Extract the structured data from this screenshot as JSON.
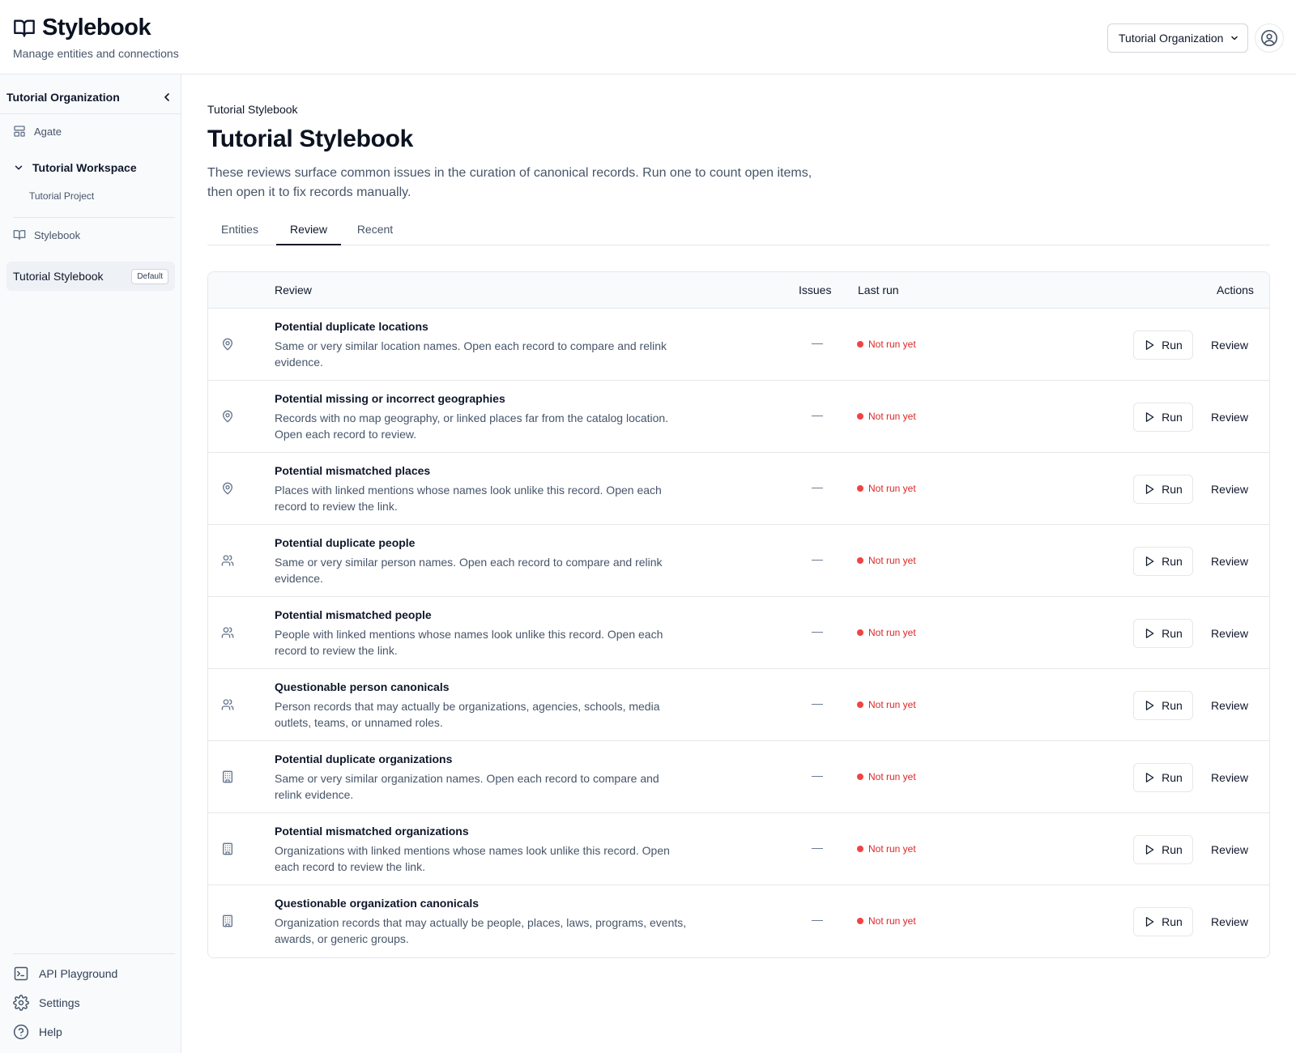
{
  "app": {
    "title": "Stylebook",
    "subtitle": "Manage entities and connections",
    "org_select": "Tutorial Organization"
  },
  "sidebar": {
    "org_name": "Tutorial Organization",
    "agate_label": "Agate",
    "workspace_label": "Tutorial Workspace",
    "project_label": "Tutorial Project",
    "stylebook_section": "Stylebook",
    "active_stylebook": "Tutorial Stylebook",
    "active_badge": "Default",
    "bottom": [
      "API Playground",
      "Settings",
      "Help"
    ]
  },
  "main": {
    "breadcrumb": "Tutorial Stylebook",
    "title": "Tutorial Stylebook",
    "description": "These reviews surface common issues in the curation of canonical records. Run one to count open items, then open it to fix records manually.",
    "tabs": [
      "Entities",
      "Review",
      "Recent"
    ],
    "active_tab": "Review"
  },
  "table": {
    "columns": {
      "review": "Review",
      "issues": "Issues",
      "last_run": "Last run",
      "actions": "Actions"
    },
    "run_label": "Run",
    "review_label": "Review",
    "rows": [
      {
        "icon": "map-pin-icon",
        "title": "Potential duplicate locations",
        "desc": "Same or very similar location names. Open each record to compare and relink evidence.",
        "issues": "—",
        "status": "Not run yet"
      },
      {
        "icon": "map-pin-icon",
        "title": "Potential missing or incorrect geographies",
        "desc": "Records with no map geography, or linked places far from the catalog location. Open each record to review.",
        "issues": "—",
        "status": "Not run yet"
      },
      {
        "icon": "map-pin-icon",
        "title": "Potential mismatched places",
        "desc": "Places with linked mentions whose names look unlike this record. Open each record to review the link.",
        "issues": "—",
        "status": "Not run yet"
      },
      {
        "icon": "users-icon",
        "title": "Potential duplicate people",
        "desc": "Same or very similar person names. Open each record to compare and relink evidence.",
        "issues": "—",
        "status": "Not run yet"
      },
      {
        "icon": "users-icon",
        "title": "Potential mismatched people",
        "desc": "People with linked mentions whose names look unlike this record. Open each record to review the link.",
        "issues": "—",
        "status": "Not run yet"
      },
      {
        "icon": "users-icon",
        "title": "Questionable person canonicals",
        "desc": "Person records that may actually be organizations, agencies, schools, media outlets, teams, or unnamed roles.",
        "issues": "—",
        "status": "Not run yet"
      },
      {
        "icon": "building-icon",
        "title": "Potential duplicate organizations",
        "desc": "Same or very similar organization names. Open each record to compare and relink evidence.",
        "issues": "—",
        "status": "Not run yet"
      },
      {
        "icon": "building-icon",
        "title": "Potential mismatched organizations",
        "desc": "Organizations with linked mentions whose names look unlike this record. Open each record to review the link.",
        "issues": "—",
        "status": "Not run yet"
      },
      {
        "icon": "building-icon",
        "title": "Questionable organization canonicals",
        "desc": "Organization records that may actually be people, places, laws, programs, events, awards, or generic groups.",
        "issues": "—",
        "status": "Not run yet"
      }
    ]
  },
  "colors": {
    "status_red": "#ef4444",
    "text_muted": "#475569",
    "border": "#e5e7eb"
  }
}
